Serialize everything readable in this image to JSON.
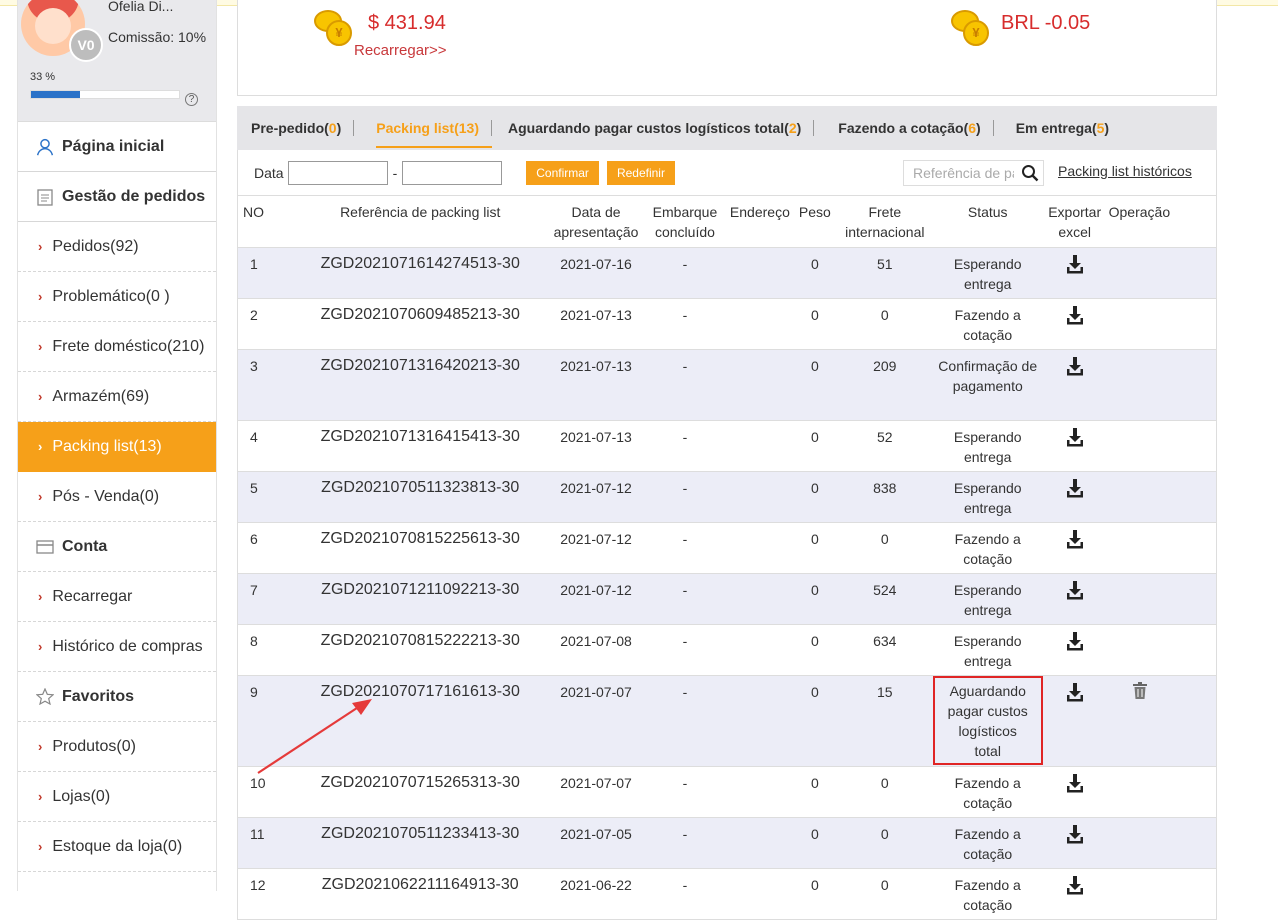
{
  "profile": {
    "username": "Ofelia Di...",
    "commission": "Comissão: 10%",
    "percent_label": "33 %",
    "progress_fraction": 0.33,
    "vip_letter": "V0"
  },
  "sidebar": {
    "home": "Página inicial",
    "orders_section": "Gestão de pedidos",
    "order_items": [
      "Pedidos(92)",
      "Problemático(0 )",
      "Frete doméstico(210)",
      "Armazém(69)",
      "Packing list(13)",
      "Pós - Venda(0)"
    ],
    "account_section": "Conta",
    "account_items": [
      "Recarregar",
      "Histórico de compras"
    ],
    "favorites_section": "Favoritos",
    "favorite_items": [
      "Produtos(0)",
      "Lojas(0)",
      "Estoque da loja(0)"
    ]
  },
  "balance": {
    "usd": "$ 431.94",
    "recharge_link": "Recarregar>>",
    "brl": "BRL -0.05",
    "coin_symbol": "¥"
  },
  "tabs": [
    {
      "label": "Pre-pedido",
      "count": "0"
    },
    {
      "label": "Packing list",
      "count": "13"
    },
    {
      "label": "Aguardando pagar custos logísticos total",
      "count": "2"
    },
    {
      "label": "Fazendo a cotação",
      "count": "6"
    },
    {
      "label": "Em entrega",
      "count": "5"
    }
  ],
  "filter": {
    "date_label": "Data",
    "dash": "-",
    "confirm": "Confirmar",
    "reset": "Redefinir",
    "search_placeholder": "Referência de packing list",
    "history_link": "Packing list históricos"
  },
  "table": {
    "headers": {
      "no": "NO",
      "ref": "Referência de packing list",
      "date": "Data de apresentação",
      "shipment": "Embarque concluído",
      "address": "Endereço",
      "weight": "Peso",
      "freight": "Frete internacional",
      "status": "Status",
      "export": "Exportar excel",
      "operation": "Operação"
    },
    "rows": [
      {
        "no": "1",
        "ref": "ZGD2021071614274513-30",
        "date": "2021-07-16",
        "shipment": "-",
        "address": "",
        "weight": "0",
        "freight": "51",
        "status": "Esperando entrega"
      },
      {
        "no": "2",
        "ref": "ZGD2021070609485213-30",
        "date": "2021-07-13",
        "shipment": "-",
        "address": "",
        "weight": "0",
        "freight": "0",
        "status": "Fazendo a cotação"
      },
      {
        "no": "3",
        "ref": "ZGD2021071316420213-30",
        "date": "2021-07-13",
        "shipment": "-",
        "address": "",
        "weight": "0",
        "freight": "209",
        "status": "Confirmação de pagamento"
      },
      {
        "no": "4",
        "ref": "ZGD2021071316415413-30",
        "date": "2021-07-13",
        "shipment": "-",
        "address": "",
        "weight": "0",
        "freight": "52",
        "status": "Esperando entrega"
      },
      {
        "no": "5",
        "ref": "ZGD2021070511323813-30",
        "date": "2021-07-12",
        "shipment": "-",
        "address": "",
        "weight": "0",
        "freight": "838",
        "status": "Esperando entrega"
      },
      {
        "no": "6",
        "ref": "ZGD2021070815225613-30",
        "date": "2021-07-12",
        "shipment": "-",
        "address": "",
        "weight": "0",
        "freight": "0",
        "status": "Fazendo a cotação"
      },
      {
        "no": "7",
        "ref": "ZGD2021071211092213-30",
        "date": "2021-07-12",
        "shipment": "-",
        "address": "",
        "weight": "0",
        "freight": "524",
        "status": "Esperando entrega"
      },
      {
        "no": "8",
        "ref": "ZGD2021070815222213-30",
        "date": "2021-07-08",
        "shipment": "-",
        "address": "",
        "weight": "0",
        "freight": "634",
        "status": "Esperando entrega"
      },
      {
        "no": "9",
        "ref": "ZGD2021070717161613-30",
        "date": "2021-07-07",
        "shipment": "-",
        "address": "",
        "weight": "0",
        "freight": "15",
        "status": "Aguardando pagar custos logísticos total"
      },
      {
        "no": "10",
        "ref": "ZGD2021070715265313-30",
        "date": "2021-07-07",
        "shipment": "-",
        "address": "",
        "weight": "0",
        "freight": "0",
        "status": "Fazendo a cotação"
      },
      {
        "no": "11",
        "ref": "ZGD2021070511233413-30",
        "date": "2021-07-05",
        "shipment": "-",
        "address": "",
        "weight": "0",
        "freight": "0",
        "status": "Fazendo a cotação"
      },
      {
        "no": "12",
        "ref": "ZGD2021062211164913-30",
        "date": "2021-06-22",
        "shipment": "-",
        "address": "",
        "weight": "0",
        "freight": "0",
        "status": "Fazendo a cotação"
      }
    ]
  },
  "colors": {
    "accent": "#f6a019",
    "money_red": "#d72c2c",
    "row_stripe": "#ecedf7",
    "highlight_box": "#e02525"
  }
}
